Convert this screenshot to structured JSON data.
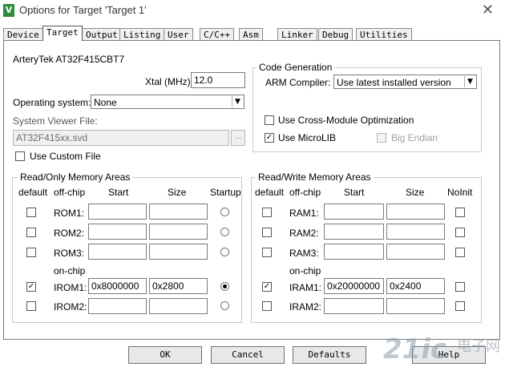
{
  "window": {
    "title": "Options for Target 'Target 1'",
    "icon": "keil-v-icon",
    "close_glyph": "✕"
  },
  "tabs": [
    "Device",
    "Target",
    "Output",
    "Listing",
    "User",
    "C/C++",
    "Asm",
    "Linker",
    "Debug",
    "Utilities"
  ],
  "active_tab": "Target",
  "device_name": "ArteryTek AT32F415CBT7",
  "xtal": {
    "label": "Xtal (MHz):",
    "value": "12.0"
  },
  "os": {
    "label": "Operating system:",
    "value": "None"
  },
  "svd": {
    "label": "System Viewer File:",
    "value": "AT32F415xx.svd",
    "browse": "..."
  },
  "use_custom_file": {
    "label": "Use Custom File",
    "checked": false
  },
  "code_gen": {
    "title": "Code Generation",
    "compiler_label": "ARM Compiler:",
    "compiler_value": "Use latest installed version",
    "cross_module": {
      "label": "Use Cross-Module Optimization",
      "checked": false
    },
    "microlib": {
      "label": "Use MicroLIB",
      "checked": true
    },
    "big_endian": {
      "label": "Big Endian",
      "checked": false
    }
  },
  "ro_memory": {
    "title": "Read/Only Memory Areas",
    "headers": {
      "default": "default",
      "offchip": "off-chip",
      "start": "Start",
      "size": "Size",
      "last": "Startup"
    },
    "onchip_label": "on-chip",
    "rows": [
      {
        "label": "ROM1:",
        "checked": false,
        "start": "",
        "size": "",
        "selected": false
      },
      {
        "label": "ROM2:",
        "checked": false,
        "start": "",
        "size": "",
        "selected": false
      },
      {
        "label": "ROM3:",
        "checked": false,
        "start": "",
        "size": "",
        "selected": false
      },
      {
        "label": "IROM1:",
        "checked": true,
        "start": "0x8000000",
        "size": "0x2800",
        "selected": true
      },
      {
        "label": "IROM2:",
        "checked": false,
        "start": "",
        "size": "",
        "selected": false
      }
    ]
  },
  "rw_memory": {
    "title": "Read/Write Memory Areas",
    "headers": {
      "default": "default",
      "offchip": "off-chip",
      "start": "Start",
      "size": "Size",
      "last": "NoInit"
    },
    "onchip_label": "on-chip",
    "rows": [
      {
        "label": "RAM1:",
        "checked": false,
        "start": "",
        "size": "",
        "noinit": false
      },
      {
        "label": "RAM2:",
        "checked": false,
        "start": "",
        "size": "",
        "noinit": false
      },
      {
        "label": "RAM3:",
        "checked": false,
        "start": "",
        "size": "",
        "noinit": false
      },
      {
        "label": "IRAM1:",
        "checked": true,
        "start": "0x20000000",
        "size": "0x2400",
        "noinit": false
      },
      {
        "label": "IRAM2:",
        "checked": false,
        "start": "",
        "size": "",
        "noinit": false
      }
    ]
  },
  "buttons": {
    "ok": "OK",
    "cancel": "Cancel",
    "defaults": "Defaults",
    "help": "Help"
  },
  "watermark": {
    "logo": "21ic",
    "text": "电子网"
  },
  "colors": {
    "check_accent": "#000000",
    "watermark": "#9aa6b2",
    "app_icon": "#2e8b3a"
  }
}
